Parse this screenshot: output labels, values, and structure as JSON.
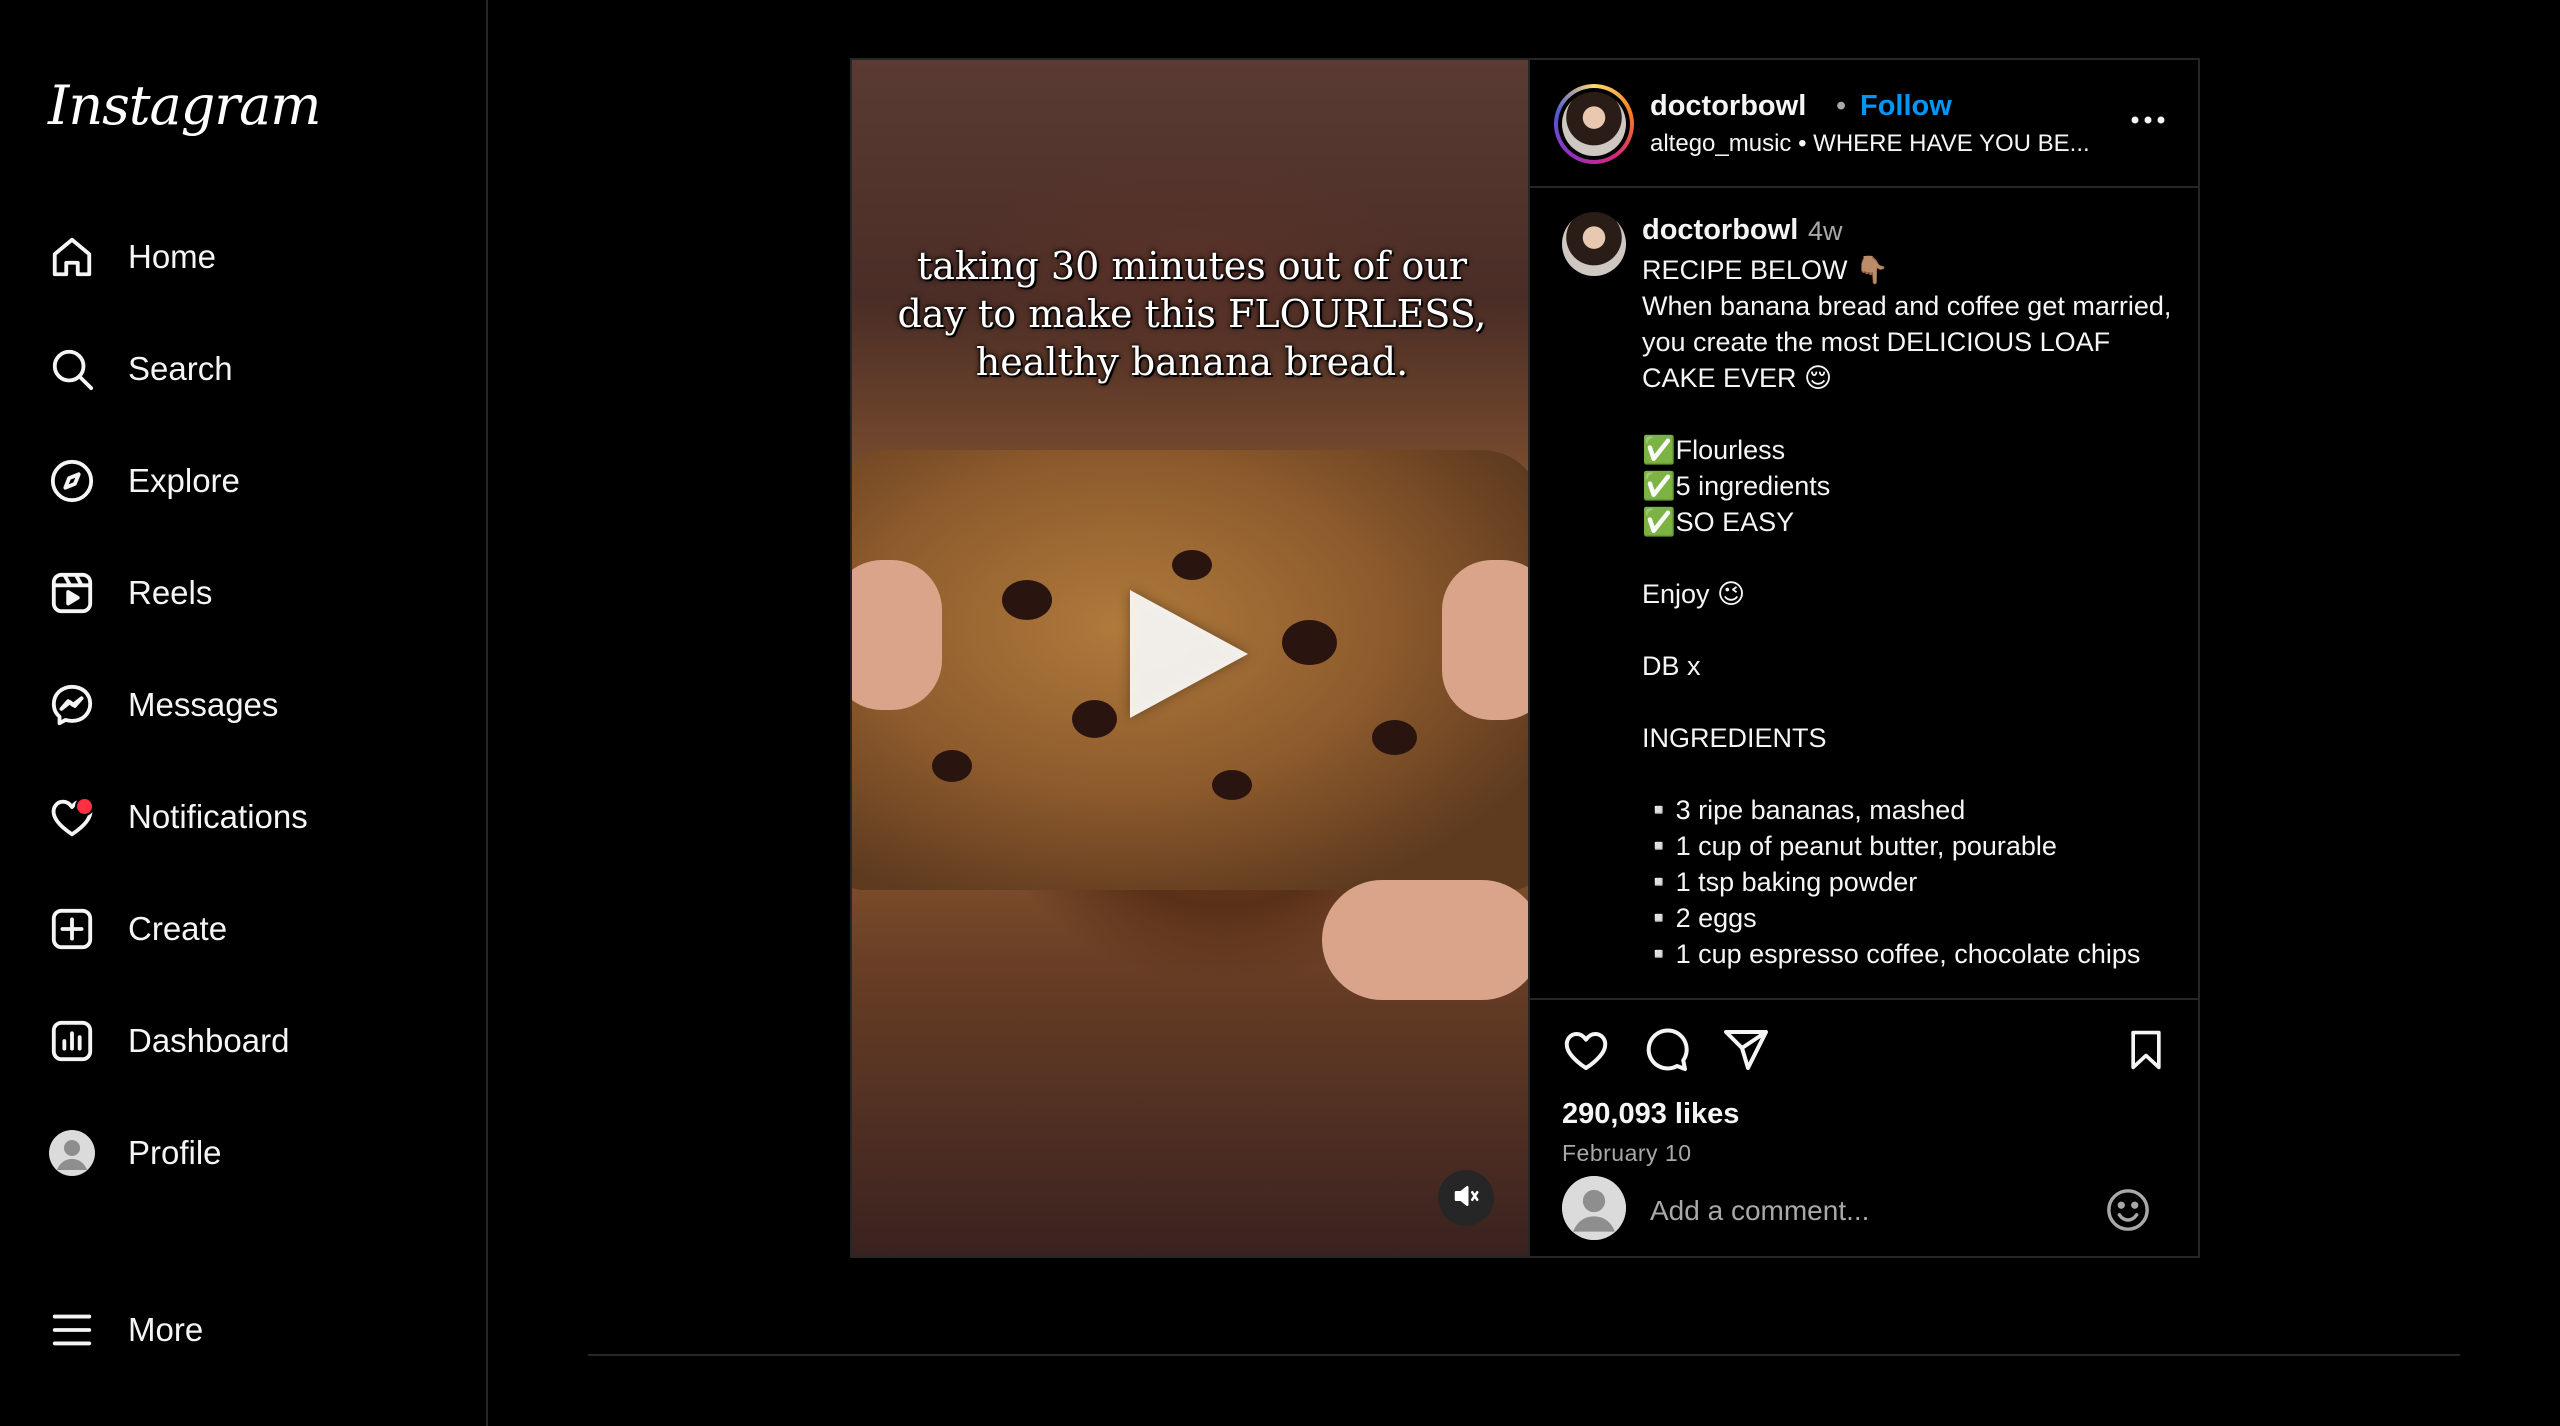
{
  "app": {
    "logo_text": "Instagram"
  },
  "sidebar": {
    "items": [
      {
        "label": "Home",
        "icon": "home-icon"
      },
      {
        "label": "Search",
        "icon": "search-icon"
      },
      {
        "label": "Explore",
        "icon": "compass-icon"
      },
      {
        "label": "Reels",
        "icon": "reels-icon"
      },
      {
        "label": "Messages",
        "icon": "messenger-icon"
      },
      {
        "label": "Notifications",
        "icon": "heart-icon"
      },
      {
        "label": "Create",
        "icon": "plus-square-icon"
      },
      {
        "label": "Dashboard",
        "icon": "dashboard-icon"
      },
      {
        "label": "Profile",
        "icon": "avatar"
      }
    ],
    "more_label": "More"
  },
  "post": {
    "overlay_text": "taking 30 minutes out of our day to make this FLOURLESS, healthy banana bread.",
    "header": {
      "username": "doctorbowl",
      "separator": "•",
      "follow_label": "Follow",
      "audio_artist": "altego_music",
      "audio_title": "WHERE HAVE YOU BE..."
    },
    "caption": {
      "username": "doctorbowl",
      "time_ago": "4w",
      "text": "RECIPE BELOW 👇🏽\nWhen banana bread and coffee get married, you create the most DELICIOUS LOAF CAKE EVER 😌\n\n✅Flourless\n✅5 ingredients\n✅SO EASY\n\nEnjoy 😉\n\nDB x\n\nINGREDIENTS\n\n▫️3 ripe bananas, mashed\n▫️1 cup of peanut butter, pourable\n▫️1 tsp baking powder\n▫️2 eggs\n▫️1 cup espresso coffee, chocolate chips"
    },
    "likes": "290,093 likes",
    "date": "February 10",
    "comment_placeholder": "Add a comment..."
  },
  "colors": {
    "background": "#000000",
    "border": "#262626",
    "follow_blue": "#0095f6",
    "notification_red": "#ff3040",
    "secondary_text": "#a8a8a8"
  }
}
